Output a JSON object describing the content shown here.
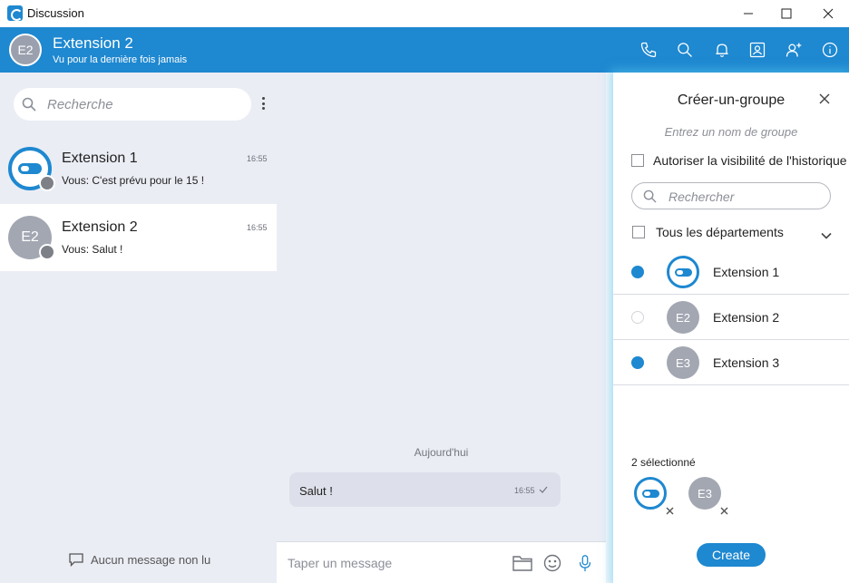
{
  "window": {
    "title": "Discussion"
  },
  "header": {
    "avatar_initials": "E2",
    "name": "Extension 2",
    "status": "Vu pour la dernière fois jamais",
    "icons": [
      "phone-icon",
      "search-icon",
      "bell-icon",
      "contact-card-icon",
      "add-user-icon",
      "info-icon"
    ]
  },
  "sidebar": {
    "search_placeholder": "Recherche",
    "conversations": [
      {
        "name": "Extension 1",
        "time": "16:55",
        "preview": "Vous: C'est prévu pour le 15 !",
        "avatar": "logo"
      },
      {
        "name": "Extension 2",
        "time": "16:55",
        "preview": "Vous: Salut !",
        "avatar_initials": "E2"
      }
    ],
    "unread_label": "Aucun message non lu"
  },
  "chat": {
    "date_separator": "Aujourd'hui",
    "messages": [
      {
        "text": "Salut !",
        "time": "16:55",
        "status": "sent-check-icon"
      }
    ],
    "composer_placeholder": "Taper un message"
  },
  "group_panel": {
    "title": "Créer-un-groupe",
    "name_placeholder": "Entrez un nom de groupe",
    "history_label": "Autoriser la visibilité de l'historique e",
    "search_placeholder": "Rechercher",
    "department_label": "Tous les départements",
    "members": [
      {
        "name": "Extension 1",
        "selected": true,
        "avatar": "logo"
      },
      {
        "name": "Extension 2",
        "selected": false,
        "avatar_initials": "E2"
      },
      {
        "name": "Extension 3",
        "selected": true,
        "avatar_initials": "E3"
      }
    ],
    "selected_count_label": "2 sélectionné",
    "selected_chip_initials": "E3",
    "create_label": "Create"
  },
  "colors": {
    "accent": "#1e88d0",
    "sidebar_bg": "#ebedf5",
    "avatar_gray": "#a3a7b2"
  }
}
